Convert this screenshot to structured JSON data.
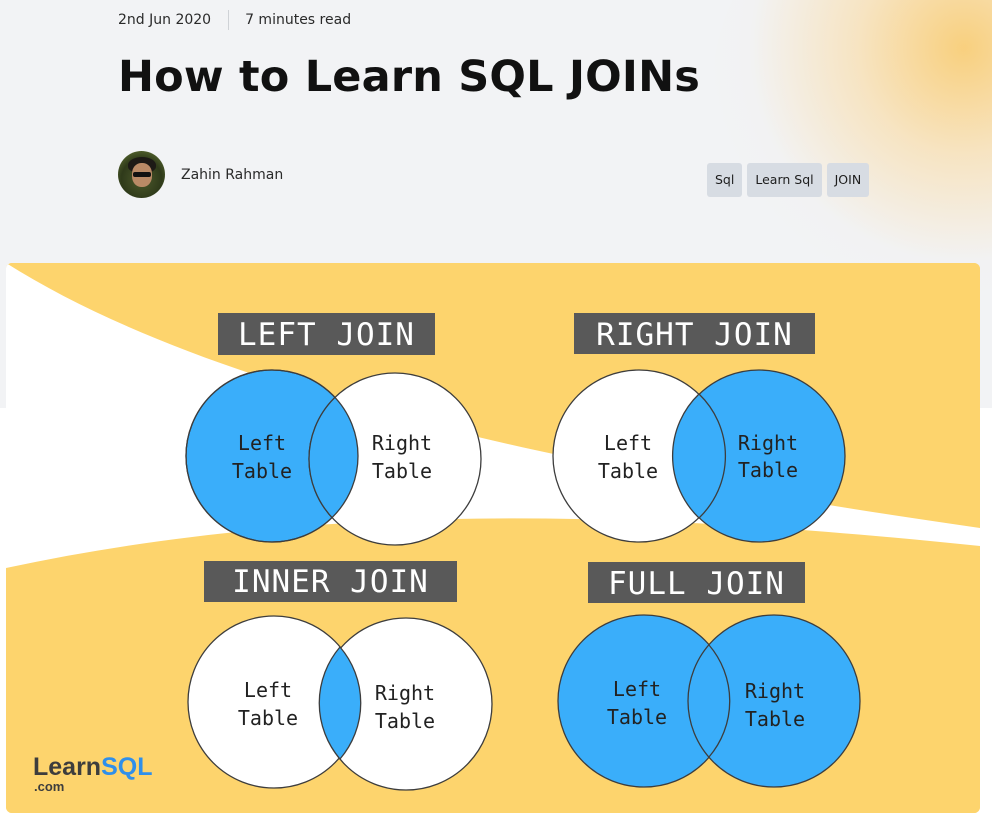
{
  "post": {
    "date": "2nd Jun 2020",
    "read_time": "7 minutes read",
    "title": "How to Learn SQL JOINs",
    "author": "Zahin Rahman",
    "tags": [
      "Sql",
      "Learn Sql",
      "JOIN"
    ]
  },
  "cover": {
    "diagrams": [
      {
        "title": "LEFT JOIN",
        "left_label": [
          "Left",
          "Table"
        ],
        "right_label": [
          "Right",
          "Table"
        ],
        "highlight": "left"
      },
      {
        "title": "RIGHT JOIN",
        "left_label": [
          "Left",
          "Table"
        ],
        "right_label": [
          "Right",
          "Table"
        ],
        "highlight": "right"
      },
      {
        "title": "INNER JOIN",
        "left_label": [
          "Left",
          "Table"
        ],
        "right_label": [
          "Right",
          "Table"
        ],
        "highlight": "inner"
      },
      {
        "title": "FULL JOIN",
        "left_label": [
          "Left",
          "Table"
        ],
        "right_label": [
          "Right",
          "Table"
        ],
        "highlight": "full"
      }
    ],
    "logo": {
      "main": "Learn",
      "accent": "SQL",
      "suffix": ".com"
    }
  },
  "colors": {
    "highlight": "#3aaefa",
    "label_bg": "#595959",
    "wave": "#fdd46d",
    "logo_main": "#3d3d3d",
    "logo_accent": "#2f8fea"
  }
}
